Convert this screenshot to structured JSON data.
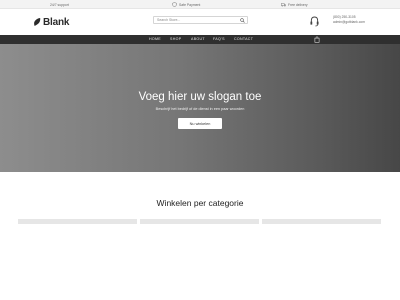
{
  "topbar": {
    "support": "24/7 support",
    "payment": "Safe Payment",
    "delivery": "Free delivery"
  },
  "header": {
    "logo_text": "Blank",
    "search_placeholder": "Search Store...",
    "phone": "(800) 250-3105",
    "email": "admin@gotblank.com"
  },
  "nav": {
    "items": [
      "HOME",
      "SHOP",
      "ABOUT",
      "FAQ'S",
      "CONTACT"
    ]
  },
  "hero": {
    "title": "Voeg hier uw slogan toe",
    "subtitle": "Beschrijf het bedrijf of de dienst in een paar woorden",
    "button_label": "Nu winkelen"
  },
  "categories": {
    "title": "Winkelen per categorie",
    "cards": 3
  },
  "colors": {
    "nav_bg": "#2f2f2f",
    "hero_gradient_start": "#8d8d8d",
    "hero_gradient_end": "#474747",
    "topbar_bg": "#f3f3f3"
  }
}
